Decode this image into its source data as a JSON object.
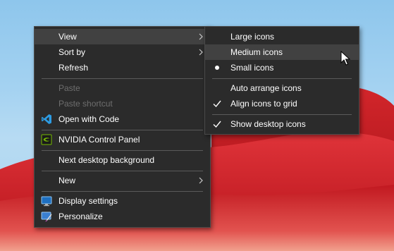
{
  "context_menu": {
    "items": [
      {
        "label": "View",
        "submenu": true,
        "hovered": true,
        "enabled": true
      },
      {
        "label": "Sort by",
        "submenu": true,
        "enabled": true
      },
      {
        "label": "Refresh",
        "enabled": true
      },
      {
        "label": "Paste",
        "enabled": false
      },
      {
        "label": "Paste shortcut",
        "enabled": false
      },
      {
        "label": "Open with Code",
        "icon": "vscode-icon",
        "enabled": true
      },
      {
        "label": "NVIDIA Control Panel",
        "icon": "nvidia-icon",
        "enabled": true
      },
      {
        "label": "Next desktop background",
        "enabled": true
      },
      {
        "label": "New",
        "submenu": true,
        "enabled": true
      },
      {
        "label": "Display settings",
        "icon": "display-settings-icon",
        "enabled": true
      },
      {
        "label": "Personalize",
        "icon": "personalize-icon",
        "enabled": true
      }
    ]
  },
  "view_submenu": {
    "items": [
      {
        "label": "Large icons",
        "mark": "none"
      },
      {
        "label": "Medium icons",
        "mark": "none",
        "hovered": true
      },
      {
        "label": "Small icons",
        "mark": "radio-dot"
      },
      {
        "label": "Auto arrange icons",
        "mark": "none"
      },
      {
        "label": "Align icons to grid",
        "mark": "checkmark"
      },
      {
        "label": "Show desktop icons",
        "mark": "checkmark"
      }
    ]
  },
  "colors": {
    "menu_background": "#2b2b2b",
    "hover_background": "#414141",
    "separator": "#5a5a5a",
    "disabled_text": "#6e6e6e",
    "text": "#ffffff",
    "wallpaper_red": "#c0141c",
    "wallpaper_sky": "#a4d2f1"
  }
}
